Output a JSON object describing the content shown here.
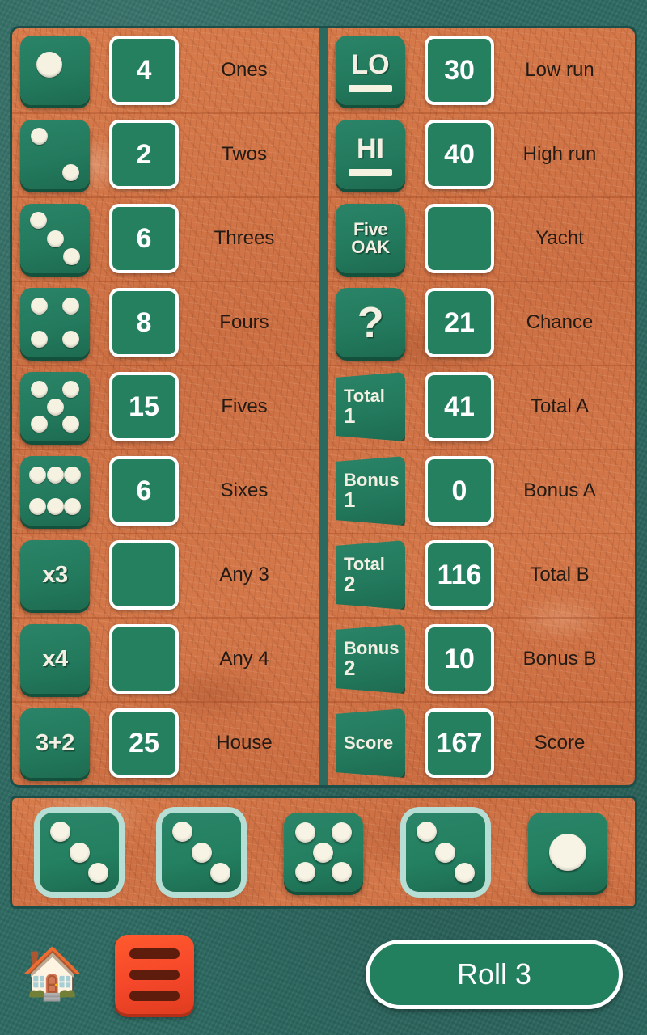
{
  "colors": {
    "felt": "#2d6b62",
    "panel_orange": "#cd7044",
    "tile_teal": "#237a5d",
    "value_teal": "#24805f",
    "pip_cream": "#f6f2e2",
    "menu_orange": "#f5472a",
    "label_dark": "#231a14",
    "frame_dark": "#1d4f4a",
    "held_outline": "#b6ded4"
  },
  "scorecard": {
    "left_column": [
      {
        "icon": "die-face-1-icon",
        "icon_kind": "die",
        "pips": 1,
        "value": "4",
        "label": "Ones"
      },
      {
        "icon": "die-face-2-icon",
        "icon_kind": "die",
        "pips": 2,
        "value": "2",
        "label": "Twos"
      },
      {
        "icon": "die-face-3-icon",
        "icon_kind": "die",
        "pips": 3,
        "value": "6",
        "label": "Threes"
      },
      {
        "icon": "die-face-4-icon",
        "icon_kind": "die",
        "pips": 4,
        "value": "8",
        "label": "Fours"
      },
      {
        "icon": "die-face-5-icon",
        "icon_kind": "die",
        "pips": 5,
        "value": "15",
        "label": "Fives"
      },
      {
        "icon": "die-face-6-icon",
        "icon_kind": "die",
        "pips": 6,
        "value": "6",
        "label": "Sixes"
      },
      {
        "icon": "three-of-a-kind-icon",
        "icon_kind": "text",
        "text": "x3",
        "value": "",
        "label": "Any 3"
      },
      {
        "icon": "four-of-a-kind-icon",
        "icon_kind": "text",
        "text": "x4",
        "value": "",
        "label": "Any 4"
      },
      {
        "icon": "full-house-icon",
        "icon_kind": "text",
        "text": "3+2",
        "value": "25",
        "label": "House"
      }
    ],
    "right_column": [
      {
        "icon": "low-run-icon",
        "icon_kind": "underlined",
        "text": "LO",
        "value": "30",
        "label": "Low run"
      },
      {
        "icon": "high-run-icon",
        "icon_kind": "underlined",
        "text": "HI",
        "value": "40",
        "label": "High run"
      },
      {
        "icon": "five-oak-icon",
        "icon_kind": "twoline",
        "line1": "Five",
        "line2": "OAK",
        "value": "",
        "label": "Yacht"
      },
      {
        "icon": "chance-icon",
        "icon_kind": "qmark",
        "text": "?",
        "value": "21",
        "label": "Chance"
      },
      {
        "icon": "total-1-icon",
        "icon_kind": "banner",
        "line1": "Total",
        "line2": "1",
        "value": "41",
        "label": "Total A"
      },
      {
        "icon": "bonus-1-icon",
        "icon_kind": "banner",
        "line1": "Bonus",
        "line2": "1",
        "value": "0",
        "label": "Bonus A"
      },
      {
        "icon": "total-2-icon",
        "icon_kind": "banner",
        "line1": "Total",
        "line2": "2",
        "value": "116",
        "label": "Total B"
      },
      {
        "icon": "bonus-2-icon",
        "icon_kind": "banner",
        "line1": "Bonus",
        "line2": "2",
        "value": "10",
        "label": "Bonus B"
      },
      {
        "icon": "score-icon",
        "icon_kind": "banner",
        "line1": "Score",
        "line2": "",
        "value": "167",
        "label": "Score"
      }
    ]
  },
  "dice_tray": {
    "dice": [
      {
        "name": "die-1",
        "pips": 3,
        "held": true
      },
      {
        "name": "die-2",
        "pips": 3,
        "held": true
      },
      {
        "name": "die-3",
        "pips": 5,
        "held": false
      },
      {
        "name": "die-4",
        "pips": 3,
        "held": true
      },
      {
        "name": "die-5",
        "pips": 1,
        "held": false
      }
    ]
  },
  "bottom_bar": {
    "home_icon": "house-icon",
    "home_glyph": "🏠",
    "menu_icon": "hamburger-menu-icon",
    "roll_label": "Roll 3"
  }
}
